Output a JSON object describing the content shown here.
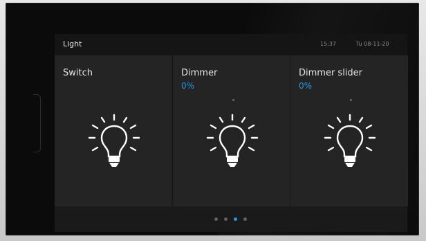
{
  "header": {
    "title": "Light",
    "time": "15:37",
    "date": "Tu 08-11-20"
  },
  "tiles": [
    {
      "name": "Switch",
      "value": "",
      "icon": "light-bulb-icon"
    },
    {
      "name": "Dimmer",
      "value": "0%",
      "icon": "light-bulb-icon"
    },
    {
      "name": "Dimmer slider",
      "value": "0%",
      "icon": "light-bulb-icon"
    }
  ],
  "pagination": {
    "pages": 4,
    "active_page": 3
  },
  "colors": {
    "accent": "#1e9be0",
    "tile_bg": "#242424",
    "header_bg": "#151515",
    "icon": "#ffffff"
  }
}
